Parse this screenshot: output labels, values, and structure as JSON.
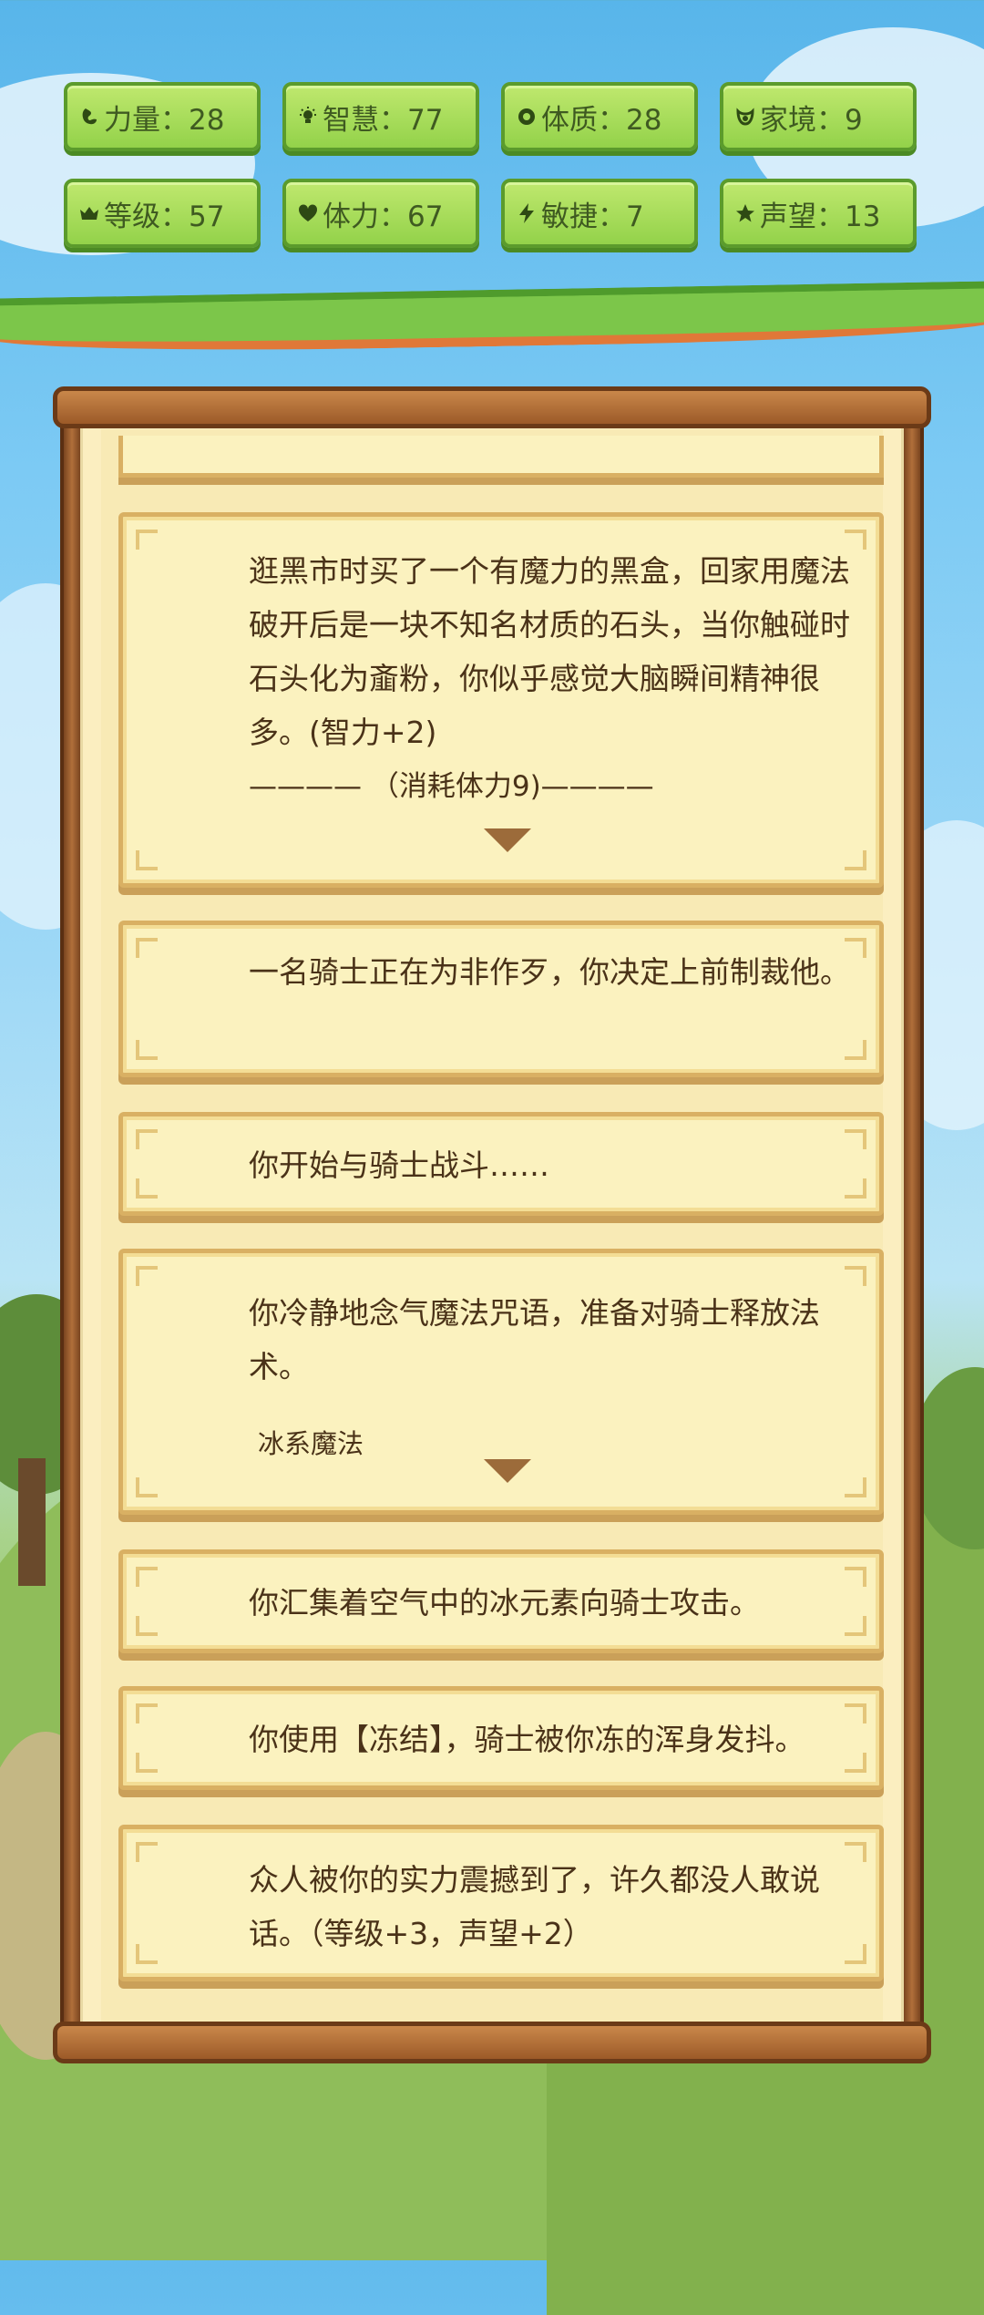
{
  "stats": [
    {
      "label": "力量：28",
      "icon": "muscle-icon"
    },
    {
      "label": "智慧：77",
      "icon": "lightbulb-icon"
    },
    {
      "label": "体质：28",
      "icon": "shield-icon"
    },
    {
      "label": "家境：9",
      "icon": "pouch-icon"
    },
    {
      "label": "等级：57",
      "icon": "crown-icon"
    },
    {
      "label": "体力：67",
      "icon": "heart-icon"
    },
    {
      "label": "敏捷：7",
      "icon": "lightning-icon"
    },
    {
      "label": "声望：13",
      "icon": "star-icon"
    }
  ],
  "events": [
    {
      "text": "逛黑市时买了一个有魔力的黑盒，回家用魔法破开后是一块不知名材质的石头，当你触碰时石头化为齑粉，你似乎感觉大脑瞬间精神很多。(智力+2)",
      "separator": "———— （消耗体力9)————"
    },
    {
      "text": "一名骑士正在为非作歹，你决定上前制裁他。"
    },
    {
      "text": "你开始与骑士战斗……"
    },
    {
      "text": "你冷静地念气魔法咒语，准备对骑士释放法术。",
      "option": "冰系魔法"
    },
    {
      "text": "你汇集着空气中的冰元素向骑士攻击。"
    },
    {
      "text": "你使用【冻结】，骑士被你冻的浑身发抖。"
    },
    {
      "text": "众人被你的实力震撼到了，许久都没人敢说话。（等级+3，声望+2）"
    }
  ]
}
